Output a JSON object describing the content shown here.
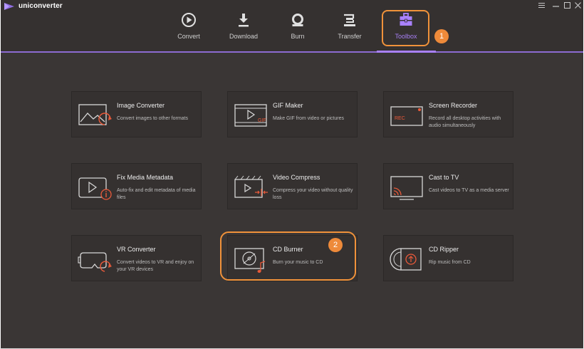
{
  "app": {
    "name": "uniconverter"
  },
  "colors": {
    "accent": "#a981ff",
    "highlight": "#f0923a",
    "background": "#3a3635",
    "card": "#353130"
  },
  "nav": [
    {
      "label": "Convert",
      "icon": "convert-icon"
    },
    {
      "label": "Download",
      "icon": "download-icon"
    },
    {
      "label": "Burn",
      "icon": "burn-icon"
    },
    {
      "label": "Transfer",
      "icon": "transfer-icon"
    },
    {
      "label": "Toolbox",
      "icon": "toolbox-icon",
      "active": true
    }
  ],
  "badges": [
    "1",
    "2"
  ],
  "tools": [
    {
      "title": "Image Converter",
      "desc": "Convert images to other formats",
      "icon": "image-converter-icon"
    },
    {
      "title": "GIF Maker",
      "desc": "Make GIF from video or pictures",
      "icon": "gif-maker-icon",
      "icon_text": "GIF"
    },
    {
      "title": "Screen Recorder",
      "desc": "Record all desktop activities with audio simultaneously",
      "icon": "screen-recorder-icon",
      "icon_text": "REC"
    },
    {
      "title": "Fix Media Metadata",
      "desc": "Auto-fix and edit metadata of media files",
      "icon": "fix-metadata-icon"
    },
    {
      "title": "Video Compress",
      "desc": "Compress your video without quality loss",
      "icon": "video-compress-icon"
    },
    {
      "title": "Cast to TV",
      "desc": "Cast videos to TV as a media server",
      "icon": "cast-to-tv-icon"
    },
    {
      "title": "VR Converter",
      "desc": "Convert videos to VR and enjoy on your VR devices",
      "icon": "vr-converter-icon"
    },
    {
      "title": "CD Burner",
      "desc": "Burn your music to CD",
      "icon": "cd-burner-icon"
    },
    {
      "title": "CD Ripper",
      "desc": "Rip music from CD",
      "icon": "cd-ripper-icon"
    }
  ]
}
